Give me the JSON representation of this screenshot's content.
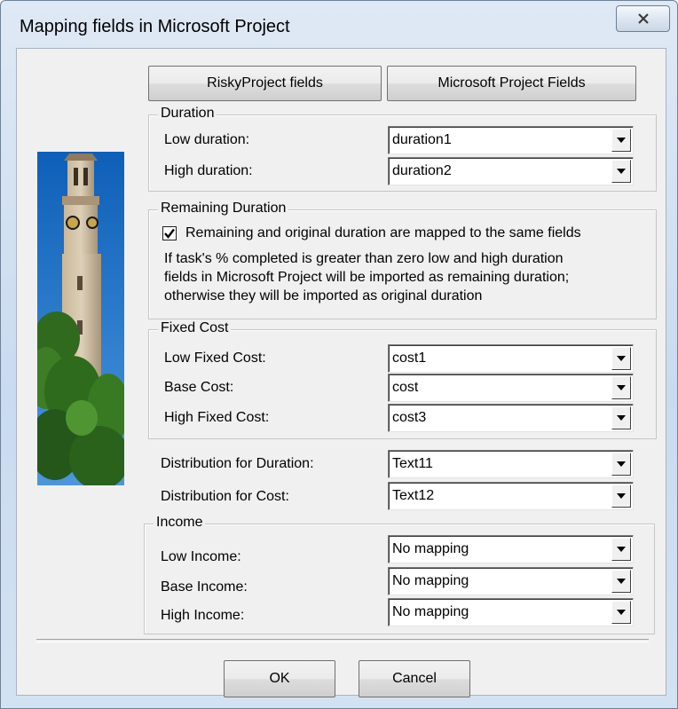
{
  "window": {
    "title": "Mapping fields in Microsoft Project"
  },
  "headers": {
    "risky": "RiskyProject fields",
    "ms": "Microsoft Project Fields"
  },
  "duration": {
    "group_label": "Duration",
    "low_label": "Low duration:",
    "low_value": "duration1",
    "high_label": "High duration:",
    "high_value": "duration2"
  },
  "remaining": {
    "group_label": "Remaining Duration",
    "checkbox_label": "Remaining and original duration are mapped to the same fields",
    "checked": true,
    "note_line1": "If task's % completed is greater than zero low and high duration",
    "note_line2": "fields in Microsoft Project will be imported as remaining duration;",
    "note_line3": "otherwise they will be imported as original duration"
  },
  "fixed_cost": {
    "group_label": "Fixed Cost",
    "low_label": "Low Fixed Cost:",
    "low_value": "cost1",
    "base_label": "Base Cost:",
    "base_value": "cost",
    "high_label": "High Fixed Cost:",
    "high_value": "cost3"
  },
  "distribution": {
    "duration_label": "Distribution for Duration:",
    "duration_value": "Text11",
    "cost_label": "Distribution for Cost:",
    "cost_value": "Text12"
  },
  "income": {
    "group_label": "Income",
    "low_label": "Low Income:",
    "low_value": "No mapping",
    "base_label": "Base Income:",
    "base_value": "No mapping",
    "high_label": "High Income:",
    "high_value": "No mapping"
  },
  "footer": {
    "ok": "OK",
    "cancel": "Cancel"
  },
  "colors": {
    "title_bar": "#c9dbef",
    "dialog_bg": "#f0f0f0",
    "sky": "#1e72c8"
  }
}
